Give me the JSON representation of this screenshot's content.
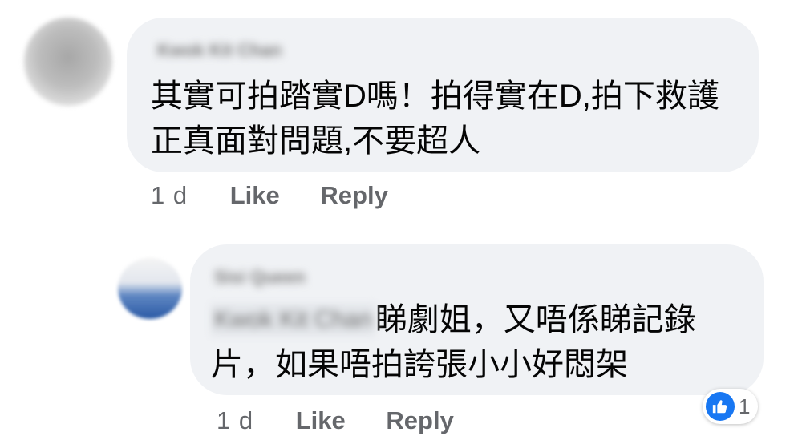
{
  "comment": {
    "author": "Kwok Kit Chan",
    "text": "其實可拍踏實D嗎！拍得實在D,拍下救護正真面對問題,不要超人",
    "time": "1 d",
    "like_label": "Like",
    "reply_label": "Reply"
  },
  "reply": {
    "author": "Sisi Queen",
    "mention": "Kwok Kit Chan",
    "text": "睇劇姐，又唔係睇記錄片，如果唔拍誇張小小好悶架",
    "time": "1 d",
    "like_label": "Like",
    "reply_label": "Reply",
    "reaction_icon": "thumbs-up-icon",
    "reaction_count": "1"
  },
  "colors": {
    "bubble": "#f0f2f5",
    "action_text": "#65676b",
    "like_blue": "#1877f2"
  }
}
